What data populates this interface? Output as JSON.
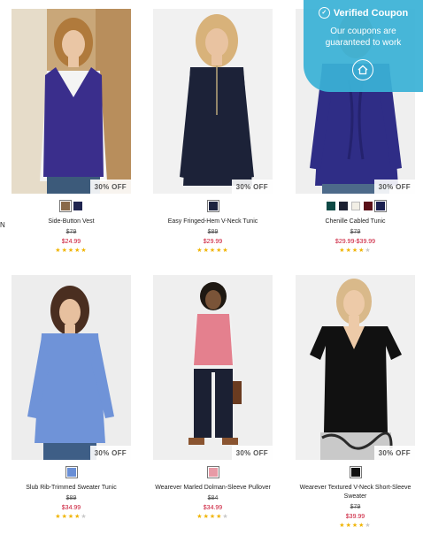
{
  "edge_text": "N",
  "coupon": {
    "title": "Verified Coupon",
    "line1": "Our coupons are",
    "line2": "guaranteed to work",
    "check_icon": "check-circle-icon",
    "home_icon": "home-icon"
  },
  "products": [
    {
      "name": "Side-Button Vest",
      "original_price": "$79",
      "sale_price": "$24.99",
      "badge": "30% OFF",
      "rating": 5,
      "swatches": [
        "#8a6a4a",
        "#1f2550"
      ]
    },
    {
      "name": "Easy Fringed-Hem V-Neck Tunic",
      "original_price": "$89",
      "sale_price": "$29.99",
      "badge": "30% OFF",
      "rating": 5,
      "swatches": [
        "#1d2440"
      ]
    },
    {
      "name": "Chenille Cabled Tunic",
      "original_price": "$79",
      "sale_price": "$29.99-$39.99",
      "badge": "30% OFF",
      "rating": 4,
      "swatches": [
        "#0f4a46",
        "#1d2233",
        "#f2efe6",
        "#5a1018",
        "#1b2050"
      ]
    },
    {
      "name": "Slub Rib-Trimmed Sweater Tunic",
      "original_price": "$89",
      "sale_price": "$34.99",
      "badge": "30% OFF",
      "rating": 4,
      "swatches": [
        "#6a8fd6"
      ]
    },
    {
      "name": "Wearever Marled Dolman-Sleeve Pullover",
      "original_price": "$84",
      "sale_price": "$34.99",
      "badge": "30% OFF",
      "rating": 4,
      "swatches": [
        "#e79aa6"
      ]
    },
    {
      "name": "Wearever Textured V-Neck Short-Sleeve Sweater",
      "original_price": "$79",
      "sale_price": "$39.99",
      "badge": "30% OFF",
      "rating": 4,
      "swatches": [
        "#111111"
      ]
    }
  ]
}
